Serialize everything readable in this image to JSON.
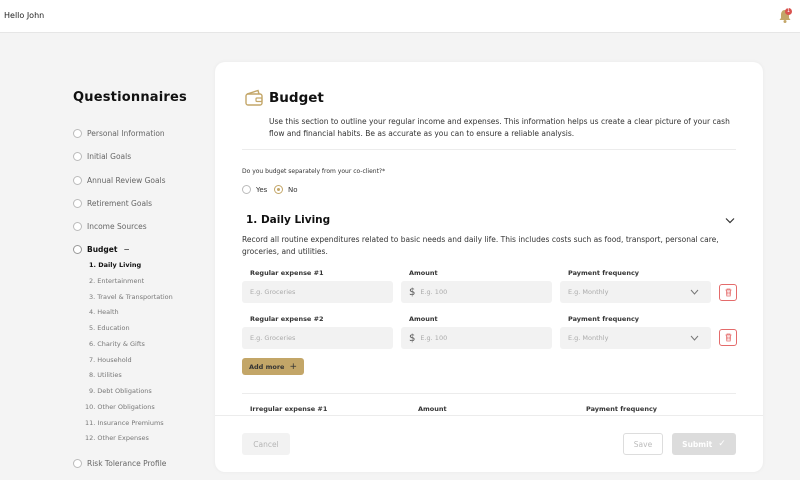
{
  "topbar": {
    "greeting": "Hello John",
    "notification_count": "1"
  },
  "sidebar": {
    "title": "Questionnaires",
    "items": [
      {
        "label": "Personal Information"
      },
      {
        "label": "Initial Goals"
      },
      {
        "label": "Annual Review Goals"
      },
      {
        "label": "Retirement Goals"
      },
      {
        "label": "Income Sources"
      },
      {
        "label": "Budget",
        "toggle": "−"
      },
      {
        "label": "Risk Tolerance Profile"
      }
    ],
    "budget_subitems": [
      "1. Daily Living",
      "2. Entertainment",
      "3. Travel & Transportation",
      "4. Health",
      "5. Education",
      "6. Charity & Gifts",
      "7. Household",
      "8. Utilities",
      "9. Debt Obligations",
      "10. Other Obligations",
      "11. Insurance Premiums",
      "12. Other Expenses"
    ]
  },
  "main": {
    "title": "Budget",
    "description": "Use this section to outline your regular income and expenses. This information helps us create a clear picture of your cash flow and financial habits. Be as accurate as you can to ensure a reliable analysis.",
    "question": "Do you budget separately from your co-client?*",
    "options": [
      "Yes",
      "No"
    ],
    "selected_option": "No",
    "section": {
      "title": "1. Daily Living",
      "description": "Record all routine expenditures related to basic needs and daily life. This includes costs such as food, transport, personal care, groceries, and utilities.",
      "rows": [
        {
          "expense_label": "Regular expense #1",
          "expense_placeholder": "E.g. Groceries",
          "amount_label": "Amount",
          "amount_placeholder": "E.g. 100",
          "frequency_label": "Payment frequency",
          "frequency_placeholder": "E.g. Monthly"
        },
        {
          "expense_label": "Regular expense #2",
          "expense_placeholder": "E.g. Groceries",
          "amount_label": "Amount",
          "amount_placeholder": "E.g. 100",
          "frequency_label": "Payment frequency",
          "frequency_placeholder": "E.g. Monthly"
        }
      ],
      "add_more_label": "Add more",
      "irregular": {
        "expense_label": "Irregular expense #1",
        "amount_label": "Amount",
        "frequency_label": "Payment frequency"
      }
    },
    "currency_symbol": "$",
    "buttons": {
      "cancel": "Cancel",
      "save": "Save",
      "submit": "Submit"
    }
  },
  "colors": {
    "accent": "#c3a668",
    "danger": "#e46b6b",
    "badge": "#d9534f"
  }
}
